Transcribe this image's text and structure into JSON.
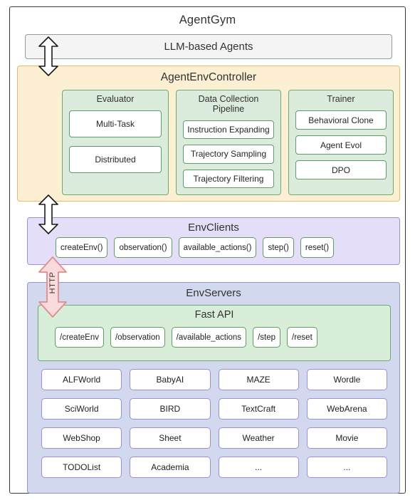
{
  "diagram": {
    "title": "AgentGym"
  },
  "agents": {
    "label": "LLM-based Agents"
  },
  "controller": {
    "title": "AgentEnvController",
    "columns": [
      {
        "head": "Evaluator",
        "items": [
          "Multi-Task",
          "Distributed"
        ]
      },
      {
        "head": "Data Collection Pipeline",
        "items": [
          "Instruction Expanding",
          "Trajectory Sampling",
          "Trajectory Filtering"
        ]
      },
      {
        "head": "Trainer",
        "items": [
          "Behavioral Clone",
          "Agent Evol",
          "DPO"
        ]
      }
    ]
  },
  "envclients": {
    "title": "EnvClients",
    "methods": [
      "createEnv()",
      "observation()",
      "available_actions()",
      "step()",
      "reset()"
    ]
  },
  "connector": {
    "http_label": "HTTP"
  },
  "envservers": {
    "title": "EnvServers",
    "fastapi": {
      "title": "Fast API",
      "endpoints": [
        "/createEnv",
        "/observation",
        "/available_actions",
        "/step",
        "/reset"
      ]
    },
    "environments": [
      "ALFWorld",
      "BabyAI",
      "MAZE",
      "Wordle",
      "SciWorld",
      "BIRD",
      "TextCraft",
      "WebArena",
      "WebShop",
      "Sheet",
      "Weather",
      "Movie",
      "TODOList",
      "Academia",
      "...",
      "..."
    ]
  },
  "colors": {
    "controller_bg": "#FCEFD2",
    "controller_border": "#E3BB6E",
    "green_bg": "#DCECDC",
    "green_border": "#6FAA74",
    "clients_bg": "#E4DEF8",
    "clients_border": "#9D8FD4",
    "servers_bg": "#D2D8EE",
    "servers_border": "#9098C9",
    "fastapi_bg": "#D8EED8",
    "http_arrow_fill": "#FADBDB",
    "http_arrow_stroke": "#E08C8C",
    "agents_bg": "#F4F4F4",
    "frame_border": "#3A3A3A"
  }
}
